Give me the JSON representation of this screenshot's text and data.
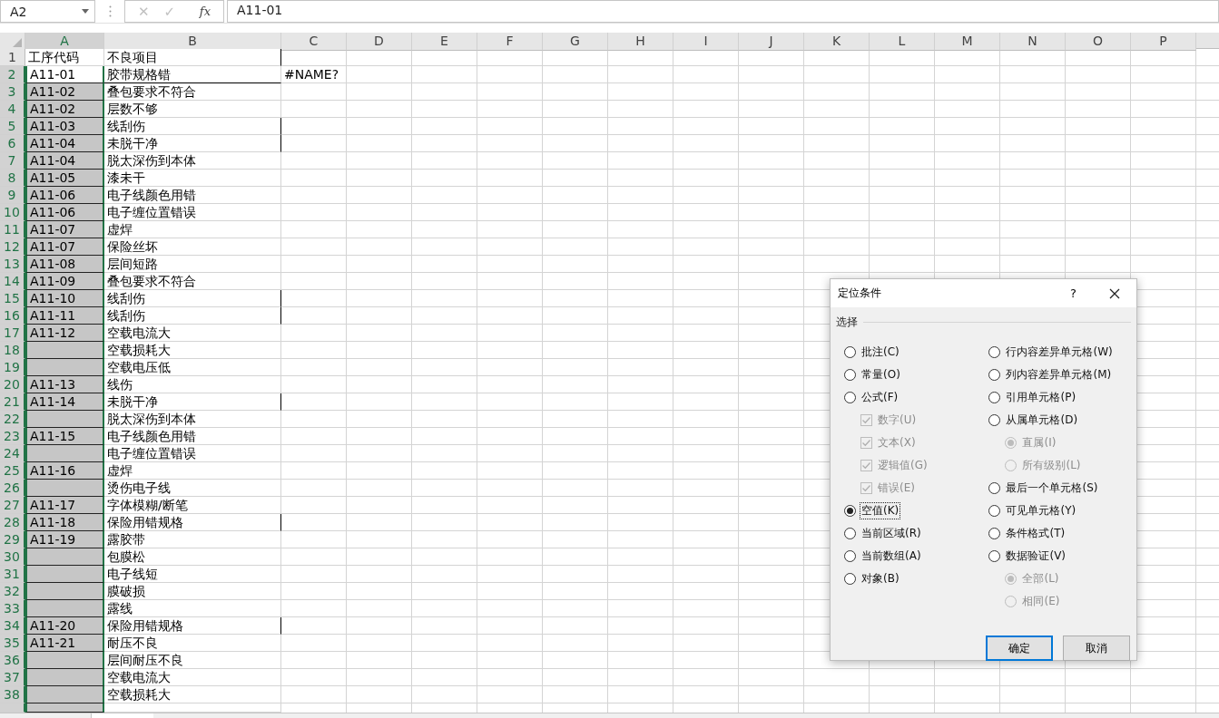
{
  "name_box": {
    "value": "A2"
  },
  "formula_bar": {
    "cancel": "✕",
    "enter": "✓",
    "function": "fx",
    "value": "A11-01"
  },
  "sheet": {
    "columns": [
      {
        "label": "A",
        "selected": true
      },
      {
        "label": "B",
        "selected": false
      },
      {
        "label": "C",
        "selected": false
      },
      {
        "label": "D",
        "selected": false
      },
      {
        "label": "E",
        "selected": false
      },
      {
        "label": "F",
        "selected": false
      },
      {
        "label": "G",
        "selected": false
      },
      {
        "label": "H",
        "selected": false
      },
      {
        "label": "I",
        "selected": false
      },
      {
        "label": "J",
        "selected": false
      },
      {
        "label": "K",
        "selected": false
      },
      {
        "label": "L",
        "selected": false
      },
      {
        "label": "M",
        "selected": false
      },
      {
        "label": "N",
        "selected": false
      },
      {
        "label": "O",
        "selected": false
      },
      {
        "label": "P",
        "selected": false
      }
    ],
    "rows": [
      {
        "number": "1",
        "selected": false,
        "active": false,
        "edge": true,
        "a": "工序代码",
        "b": "不良项目"
      },
      {
        "number": "2",
        "selected": true,
        "active": true,
        "edge": false,
        "a": "A11-01",
        "b": "胶带规格错",
        "c": "#NAME?"
      },
      {
        "number": "3",
        "selected": true,
        "active": false,
        "edge": false,
        "a": "A11-02",
        "b": "叠包要求不符合"
      },
      {
        "number": "4",
        "selected": true,
        "active": false,
        "edge": false,
        "a": "A11-02",
        "b": "层数不够"
      },
      {
        "number": "5",
        "selected": true,
        "active": false,
        "edge": true,
        "a": "A11-03",
        "b": "线刮伤"
      },
      {
        "number": "6",
        "selected": true,
        "active": false,
        "edge": true,
        "a": "A11-04",
        "b": "未脱干净"
      },
      {
        "number": "7",
        "selected": true,
        "active": false,
        "edge": false,
        "a": "A11-04",
        "b": "脱太深伤到本体"
      },
      {
        "number": "8",
        "selected": true,
        "active": false,
        "edge": false,
        "a": "A11-05",
        "b": "漆未干"
      },
      {
        "number": "9",
        "selected": true,
        "active": false,
        "edge": false,
        "a": "A11-06",
        "b": "电子线颜色用错"
      },
      {
        "number": "10",
        "selected": true,
        "active": false,
        "edge": false,
        "a": "A11-06",
        "b": "电子缠位置错误"
      },
      {
        "number": "11",
        "selected": true,
        "active": false,
        "edge": false,
        "a": "A11-07",
        "b": "虚焊"
      },
      {
        "number": "12",
        "selected": true,
        "active": false,
        "edge": false,
        "a": "A11-07",
        "b": "保险丝坏"
      },
      {
        "number": "13",
        "selected": true,
        "active": false,
        "edge": false,
        "a": "A11-08",
        "b": "层间短路"
      },
      {
        "number": "14",
        "selected": true,
        "active": false,
        "edge": false,
        "a": "A11-09",
        "b": "叠包要求不符合"
      },
      {
        "number": "15",
        "selected": true,
        "active": false,
        "edge": true,
        "a": "A11-10",
        "b": "线刮伤"
      },
      {
        "number": "16",
        "selected": true,
        "active": false,
        "edge": true,
        "a": "A11-11",
        "b": "线刮伤"
      },
      {
        "number": "17",
        "selected": true,
        "active": false,
        "edge": false,
        "a": "A11-12",
        "b": "空载电流大"
      },
      {
        "number": "18",
        "selected": true,
        "active": false,
        "edge": false,
        "b": "空载损耗大"
      },
      {
        "number": "19",
        "selected": true,
        "active": false,
        "edge": false,
        "b": "空载电压低"
      },
      {
        "number": "20",
        "selected": true,
        "active": false,
        "edge": false,
        "a": "A11-13",
        "b": "线伤"
      },
      {
        "number": "21",
        "selected": true,
        "active": false,
        "edge": true,
        "a": "A11-14",
        "b": "未脱干净"
      },
      {
        "number": "22",
        "selected": true,
        "active": false,
        "edge": false,
        "b": "脱太深伤到本体"
      },
      {
        "number": "23",
        "selected": true,
        "active": false,
        "edge": false,
        "a": "A11-15",
        "b": "电子线颜色用错"
      },
      {
        "number": "24",
        "selected": true,
        "active": false,
        "edge": false,
        "b": "电子缠位置错误"
      },
      {
        "number": "25",
        "selected": true,
        "active": false,
        "edge": false,
        "a": "A11-16",
        "b": "虚焊"
      },
      {
        "number": "26",
        "selected": true,
        "active": false,
        "edge": false,
        "b": "烫伤电子线"
      },
      {
        "number": "27",
        "selected": true,
        "active": false,
        "edge": false,
        "a": "A11-17",
        "b": "字体模糊/断笔"
      },
      {
        "number": "28",
        "selected": true,
        "active": false,
        "edge": true,
        "a": "A11-18",
        "b": "保险用错规格"
      },
      {
        "number": "29",
        "selected": true,
        "active": false,
        "edge": false,
        "a": "A11-19",
        "b": "露胶带"
      },
      {
        "number": "30",
        "selected": true,
        "active": false,
        "edge": false,
        "b": "包膜松"
      },
      {
        "number": "31",
        "selected": true,
        "active": false,
        "edge": false,
        "b": "电子线短"
      },
      {
        "number": "32",
        "selected": true,
        "active": false,
        "edge": false,
        "b": "膜破损"
      },
      {
        "number": "33",
        "selected": true,
        "active": false,
        "edge": false,
        "b": "露线"
      },
      {
        "number": "34",
        "selected": true,
        "active": false,
        "edge": true,
        "a": "A11-20",
        "b": "保险用错规格"
      },
      {
        "number": "35",
        "selected": true,
        "active": false,
        "edge": false,
        "a": "A11-21",
        "b": "耐压不良"
      },
      {
        "number": "36",
        "selected": true,
        "active": false,
        "edge": false,
        "b": "层间耐压不良"
      },
      {
        "number": "37",
        "selected": true,
        "active": false,
        "edge": false,
        "b": "空载电流大"
      },
      {
        "number": "38",
        "selected": true,
        "active": false,
        "edge": false,
        "b": "空载损耗大"
      }
    ]
  },
  "dialog": {
    "title": "定位条件",
    "help": "?",
    "group": "选择",
    "left_column": [
      {
        "kind": "radio",
        "label": "批注(C)",
        "selected": false,
        "disabled": false
      },
      {
        "kind": "radio",
        "label": "常量(O)",
        "selected": false,
        "disabled": false
      },
      {
        "kind": "radio",
        "label": "公式(F)",
        "selected": false,
        "disabled": false,
        "children": [
          {
            "kind": "checkbox",
            "label": "数字(U)",
            "checked": true,
            "disabled": true
          },
          {
            "kind": "checkbox",
            "label": "文本(X)",
            "checked": true,
            "disabled": true
          },
          {
            "kind": "checkbox",
            "label": "逻辑值(G)",
            "checked": true,
            "disabled": true
          },
          {
            "kind": "checkbox",
            "label": "错误(E)",
            "checked": true,
            "disabled": true
          }
        ]
      },
      {
        "kind": "radio",
        "label": "空值(K)",
        "selected": true,
        "disabled": false
      },
      {
        "kind": "radio",
        "label": "当前区域(R)",
        "selected": false,
        "disabled": false
      },
      {
        "kind": "radio",
        "label": "当前数组(A)",
        "selected": false,
        "disabled": false
      },
      {
        "kind": "radio",
        "label": "对象(B)",
        "selected": false,
        "disabled": false
      }
    ],
    "right_column": [
      {
        "kind": "radio",
        "label": "行内容差异单元格(W)",
        "selected": false,
        "disabled": false
      },
      {
        "kind": "radio",
        "label": "列内容差异单元格(M)",
        "selected": false,
        "disabled": false
      },
      {
        "kind": "radio",
        "label": "引用单元格(P)",
        "selected": false,
        "disabled": false
      },
      {
        "kind": "radio",
        "label": "从属单元格(D)",
        "selected": false,
        "disabled": false,
        "children": [
          {
            "kind": "radio",
            "label": "直属(I)",
            "selected": true,
            "disabled": true
          },
          {
            "kind": "radio",
            "label": "所有级别(L)",
            "selected": false,
            "disabled": true
          }
        ]
      },
      {
        "kind": "radio",
        "label": "最后一个单元格(S)",
        "selected": false,
        "disabled": false
      },
      {
        "kind": "radio",
        "label": "可见单元格(Y)",
        "selected": false,
        "disabled": false
      },
      {
        "kind": "radio",
        "label": "条件格式(T)",
        "selected": false,
        "disabled": false
      },
      {
        "kind": "radio",
        "label": "数据验证(V)",
        "selected": false,
        "disabled": false,
        "children": [
          {
            "kind": "radio",
            "label": "全部(L)",
            "selected": true,
            "disabled": true
          },
          {
            "kind": "radio",
            "label": "相同(E)",
            "selected": false,
            "disabled": true
          }
        ]
      }
    ],
    "buttons": [
      {
        "label": "确定",
        "default": true
      },
      {
        "label": "取消",
        "default": false
      }
    ]
  }
}
